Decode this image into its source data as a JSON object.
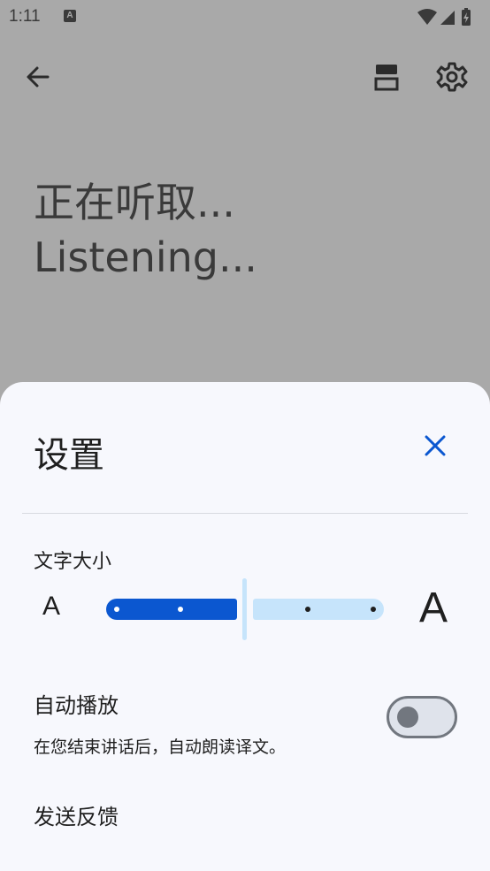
{
  "status_bar": {
    "time": "1:11",
    "app_icon_letter": "A",
    "icons": [
      "wifi-icon",
      "signal-icon",
      "battery-charging-icon"
    ]
  },
  "top_bar": {
    "icons": [
      "back-arrow-icon",
      "split-layout-icon",
      "gear-icon"
    ]
  },
  "main": {
    "listening_line_1": "正在听取...",
    "listening_line_2": "Listening..."
  },
  "settings_sheet": {
    "title": "设置",
    "close_icon": "close-icon",
    "font_size": {
      "label": "文字大小",
      "small_glyph": "A",
      "large_glyph": "A",
      "steps": 4,
      "current_step": 2
    },
    "autoplay": {
      "title": "自动播放",
      "description": "在您结束讲话后，自动朗读译文。",
      "enabled": false
    },
    "feedback_label": "发送反馈"
  },
  "colors": {
    "scrim": "#a9a9a9",
    "sheet_bg": "#f7f8fd",
    "accent": "#0b57d0",
    "slider_inactive": "#c6e4fb"
  }
}
